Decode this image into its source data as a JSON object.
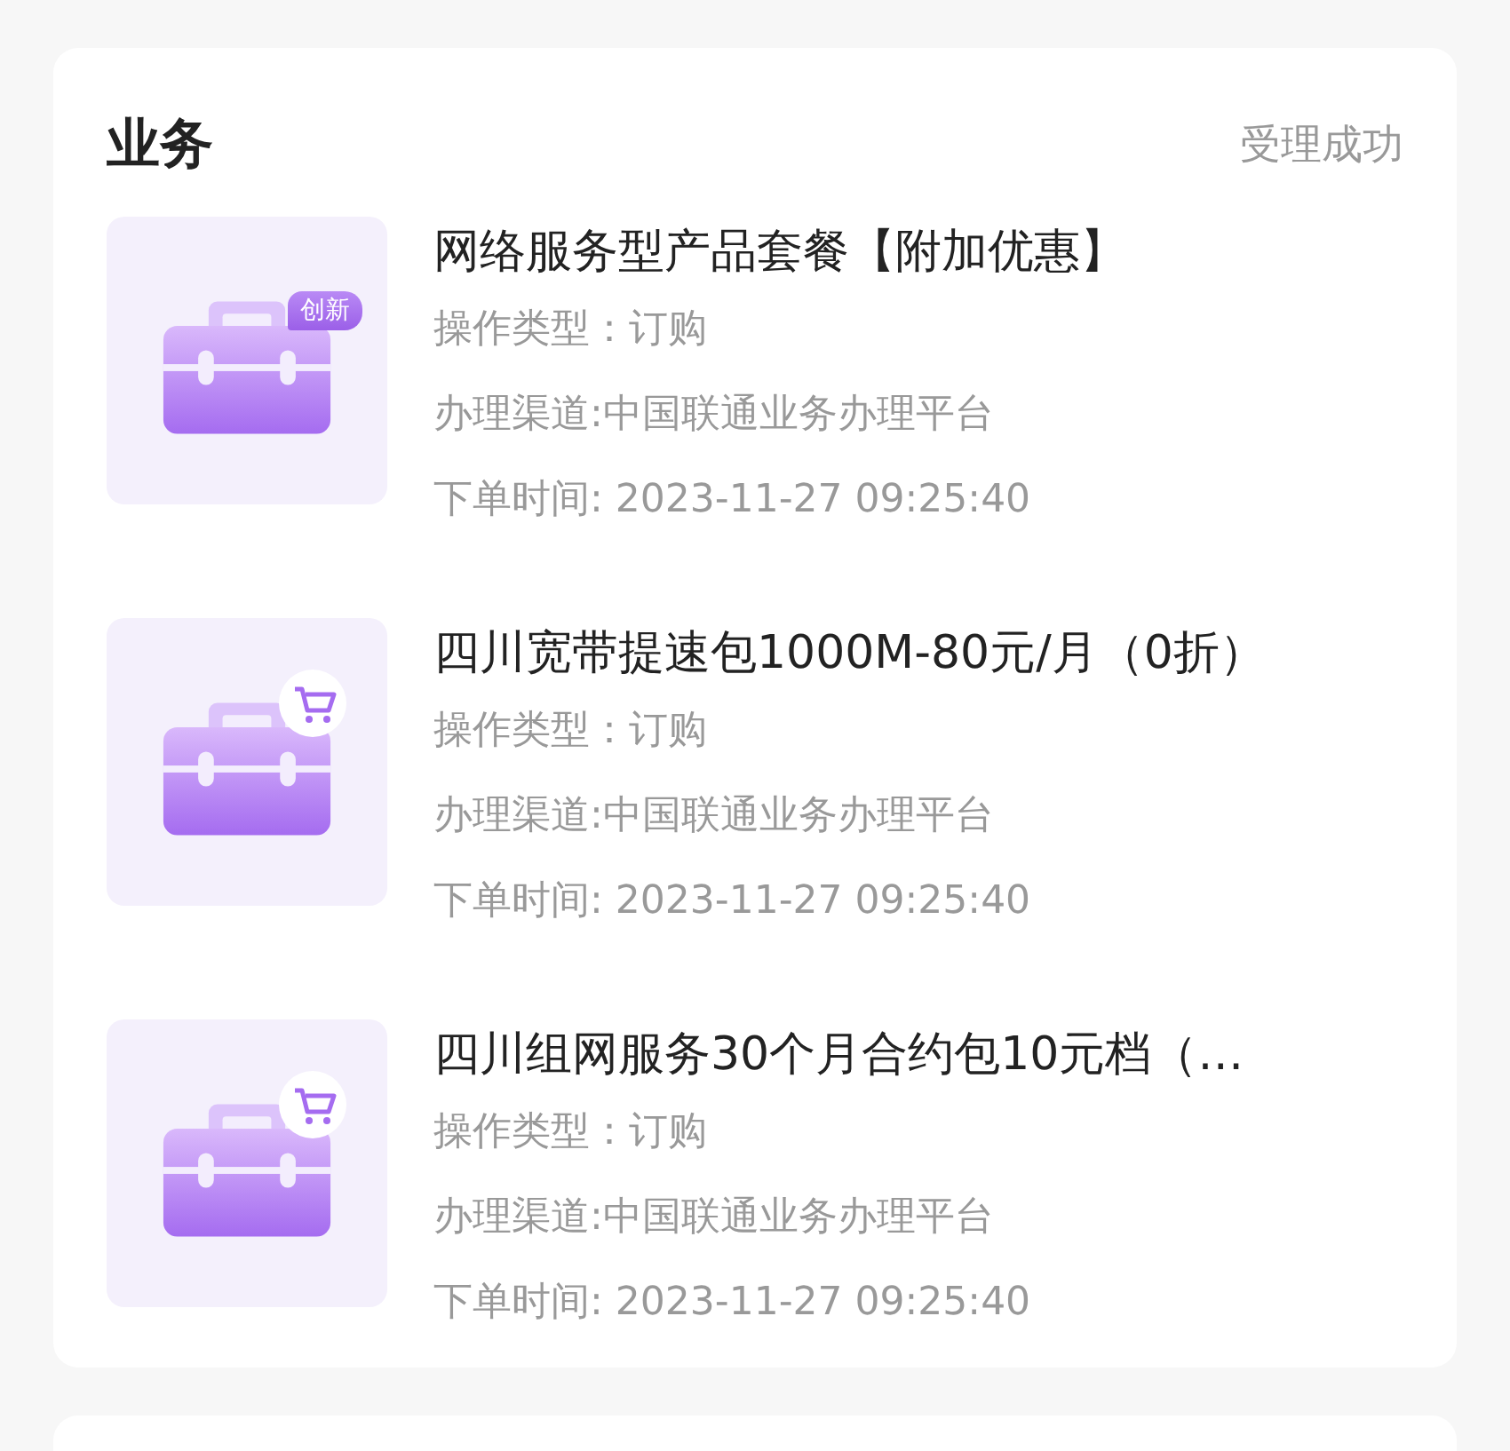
{
  "section": {
    "title": "业务",
    "status": "受理成功"
  },
  "orders": [
    {
      "badge": {
        "kind": "text",
        "label": "创新"
      },
      "name": "网络服务型产品套餐【附加优惠】",
      "details": [
        "操作类型：订购",
        "办理渠道:中国联通业务办理平台",
        "下单时间: 2023-11-27 09:25:40"
      ]
    },
    {
      "badge": {
        "kind": "cart"
      },
      "name": "四川宽带提速包1000M-80元/月（0折）",
      "details": [
        "操作类型：订购",
        "办理渠道:中国联通业务办理平台",
        "下单时间: 2023-11-27 09:25:40"
      ]
    },
    {
      "badge": {
        "kind": "cart"
      },
      "name": "四川组网服务30个月合约包10元档（…",
      "details": [
        "操作类型：订购",
        "办理渠道:中国联通业务办理平台",
        "下单时间: 2023-11-27 09:25:40"
      ]
    }
  ]
}
